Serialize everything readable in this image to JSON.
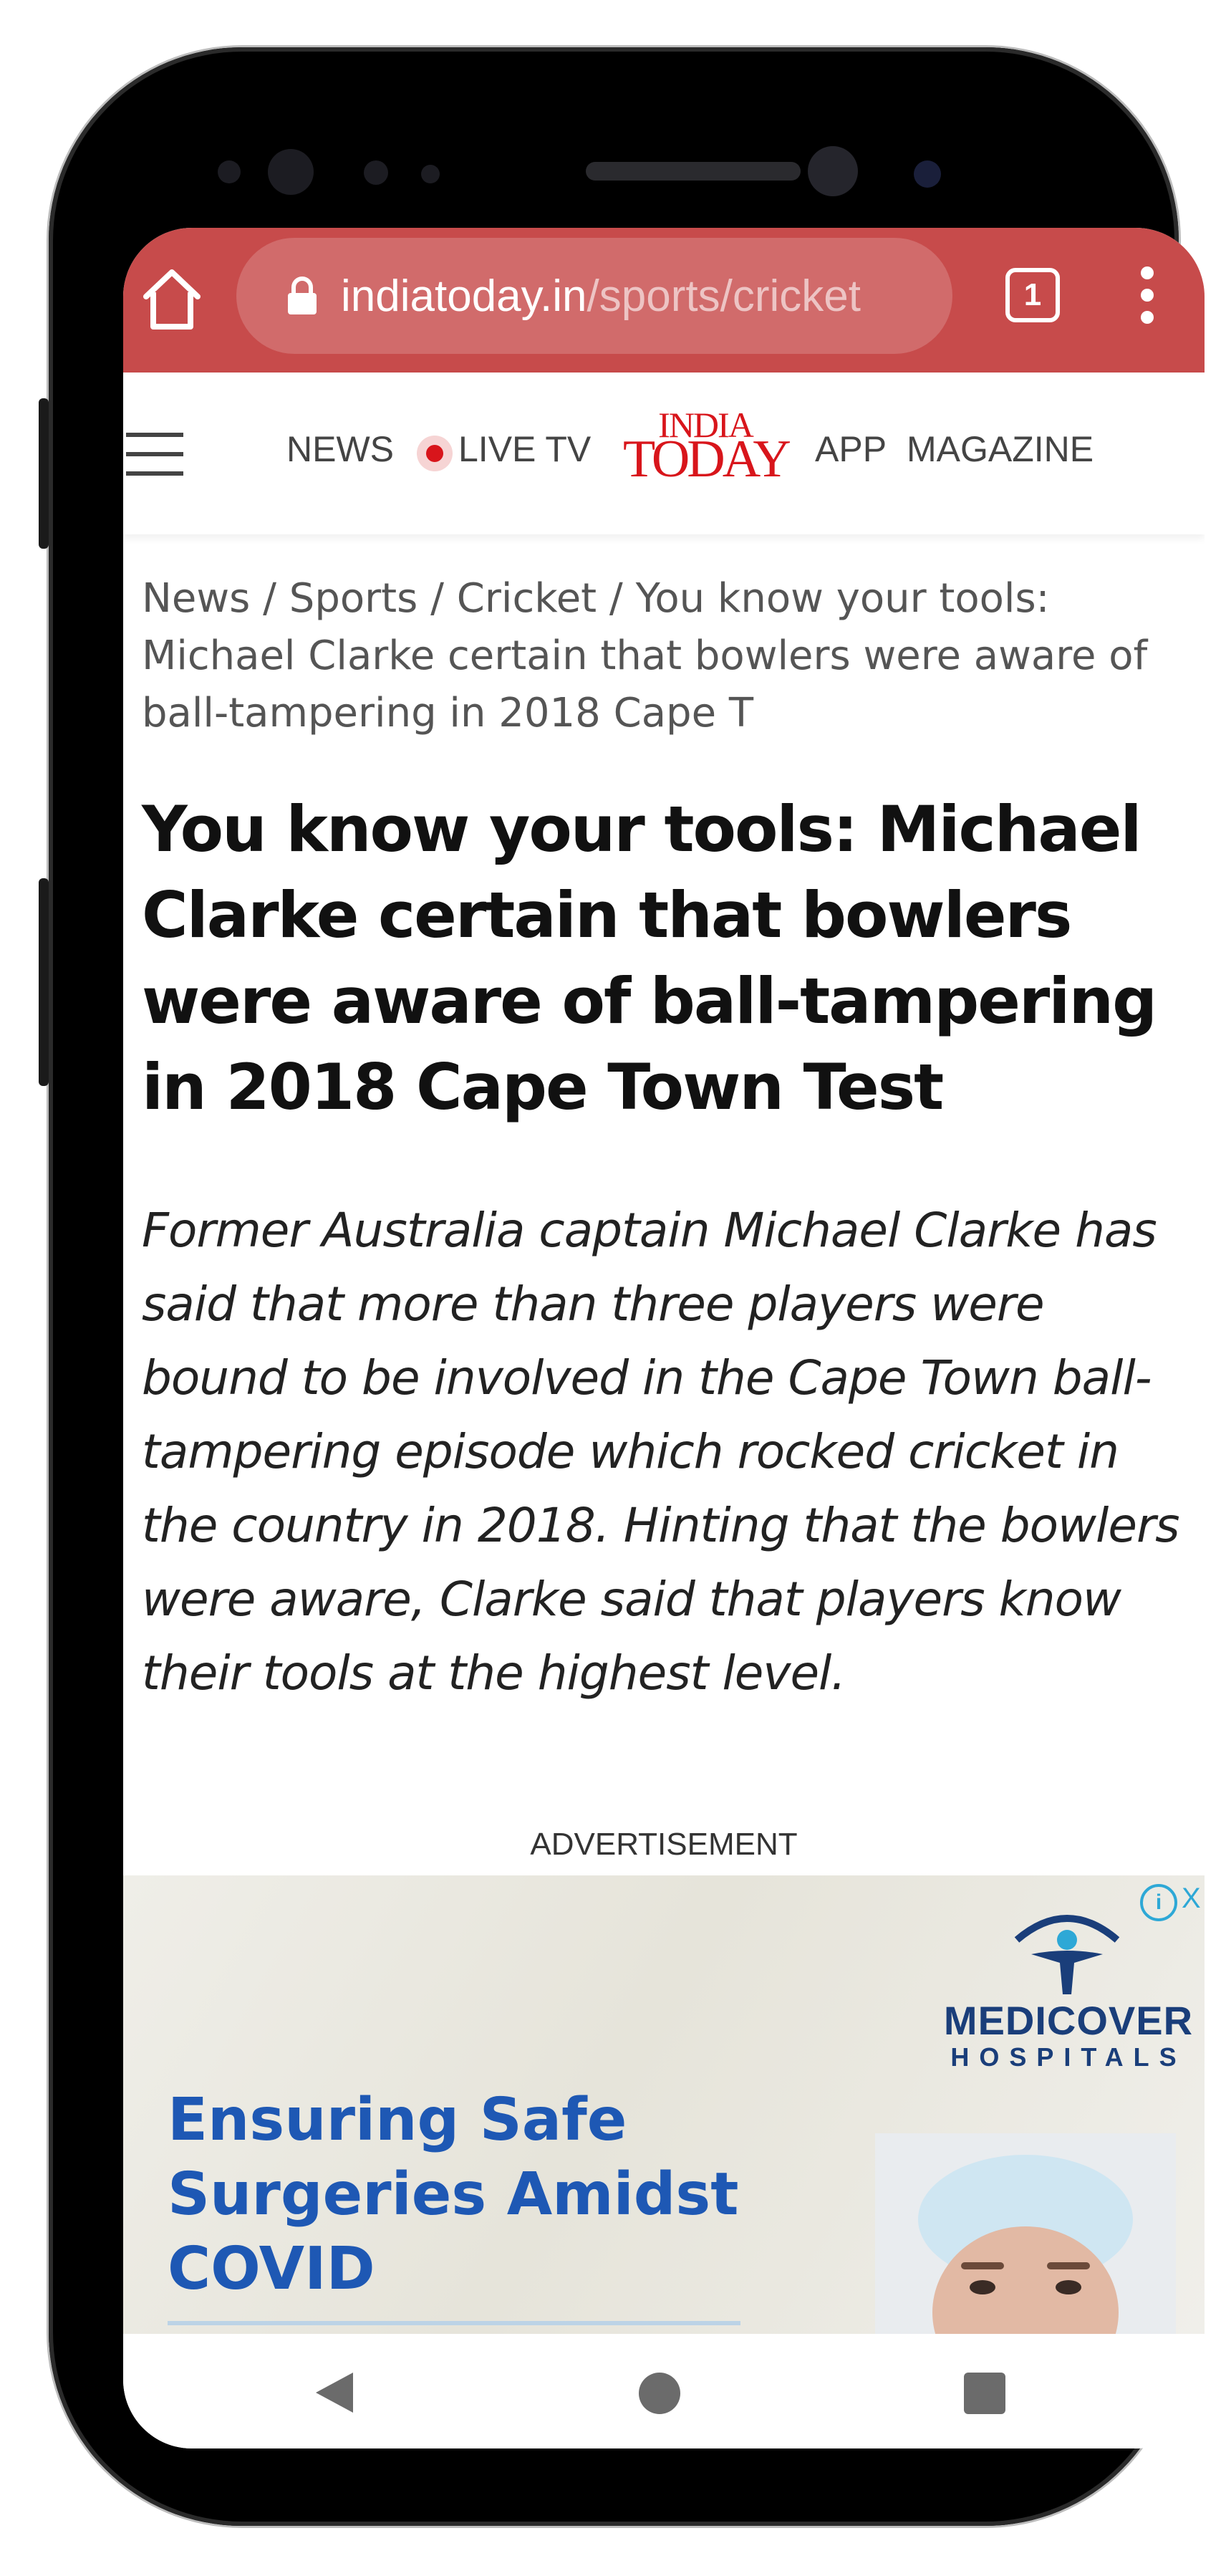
{
  "browser": {
    "url_domain": "indiatoday.in",
    "url_path": "/sports/cricket",
    "tab_count": "1",
    "home_icon": "home-icon",
    "lock_icon": "lock-icon",
    "menu_icon": "more-vert-icon",
    "toolbar_color": "#c74b4b"
  },
  "site_nav": {
    "menu_icon": "hamburger-icon",
    "items": {
      "news": "NEWS",
      "live_tv": "LIVE TV",
      "app": "APP",
      "magazine": "MAGAZINE"
    },
    "logo_line1": "INDIA",
    "logo_line2": "TODAY",
    "brand_color": "#d8151b"
  },
  "breadcrumb": {
    "news": "News",
    "sports": "Sports",
    "cricket": "Cricket",
    "separator": " / ",
    "current": "You know your tools: Michael Clarke certain that bowlers were aware of ball-tampering in 2018 Cape T"
  },
  "article": {
    "headline": "You know your tools: Michael Clarke certain that bowlers were aware of ball-tampering in 2018 Cape Town Test",
    "summary": "Former Australia captain Michael Clarke has said that more than three players were bound to be involved in the Cape Town ball-tampering episode which rocked cricket in the country in 2018. Hinting that the bowlers were aware, Clarke said that players know their tools at the highest level."
  },
  "advertisement": {
    "label": "ADVERTISEMENT",
    "info_glyph": "i",
    "close_glyph": "X",
    "brand_line1": "MEDICOVER",
    "brand_line2": "HOSPITALS",
    "headline": "Ensuring Safe Surgeries Amidst COVID",
    "headline_color": "#1e58b4"
  },
  "system_nav": {
    "back_icon": "back-triangle-icon",
    "home_icon": "home-circle-icon",
    "recents_icon": "recents-square-icon"
  }
}
